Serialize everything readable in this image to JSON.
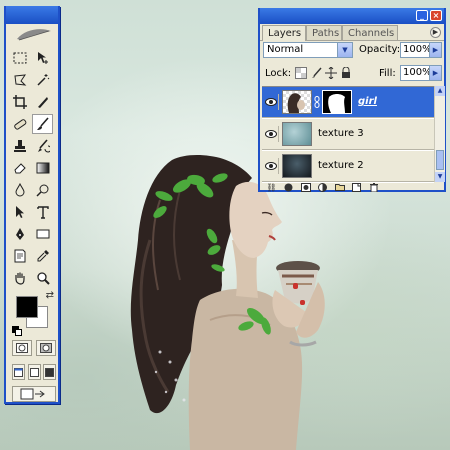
{
  "toolbox": {
    "tools": [
      {
        "name": "marquee-icon",
        "glyph": ""
      },
      {
        "name": "move-icon",
        "glyph": "✥"
      },
      {
        "name": "lasso-icon",
        "glyph": ""
      },
      {
        "name": "magic-wand-icon",
        "glyph": "✶"
      },
      {
        "name": "crop-icon",
        "glyph": ""
      },
      {
        "name": "slice-icon",
        "glyph": "✎"
      },
      {
        "name": "healing-brush-icon",
        "glyph": "✚"
      },
      {
        "name": "brush-icon",
        "glyph": "✎"
      },
      {
        "name": "clone-stamp-icon",
        "glyph": "♜"
      },
      {
        "name": "history-brush-icon",
        "glyph": "✐"
      },
      {
        "name": "eraser-icon",
        "glyph": "▱"
      },
      {
        "name": "gradient-icon",
        "glyph": "▮"
      },
      {
        "name": "blur-icon",
        "glyph": "💧"
      },
      {
        "name": "dodge-icon",
        "glyph": "◔"
      },
      {
        "name": "path-selection-icon",
        "glyph": "➤"
      },
      {
        "name": "type-icon",
        "glyph": "T"
      },
      {
        "name": "pen-icon",
        "glyph": "✒"
      },
      {
        "name": "shape-icon",
        "glyph": "▭"
      },
      {
        "name": "notes-icon",
        "glyph": "▤"
      },
      {
        "name": "eyedropper-icon",
        "glyph": "✐"
      },
      {
        "name": "hand-icon",
        "glyph": "✋"
      },
      {
        "name": "zoom-icon",
        "glyph": "🔍"
      }
    ],
    "foreground_color": "#000000",
    "background_color": "#ffffff"
  },
  "layers_panel": {
    "tabs": [
      "Layers",
      "Paths",
      "Channels"
    ],
    "blend_mode": "Normal",
    "opacity_label": "Opacity:",
    "opacity_value": "100%",
    "lock_label": "Lock:",
    "fill_label": "Fill:",
    "fill_value": "100%",
    "layers": [
      {
        "name": "girl",
        "visible": true,
        "selected": true,
        "has_mask": true
      },
      {
        "name": "texture 3",
        "visible": true,
        "selected": false,
        "has_mask": false
      },
      {
        "name": "texture 2",
        "visible": true,
        "selected": false,
        "has_mask": false
      }
    ]
  },
  "colors": {
    "title_bar": "#1e50c8",
    "selection": "#3168d5",
    "panel_bg": "#ece9d8"
  }
}
